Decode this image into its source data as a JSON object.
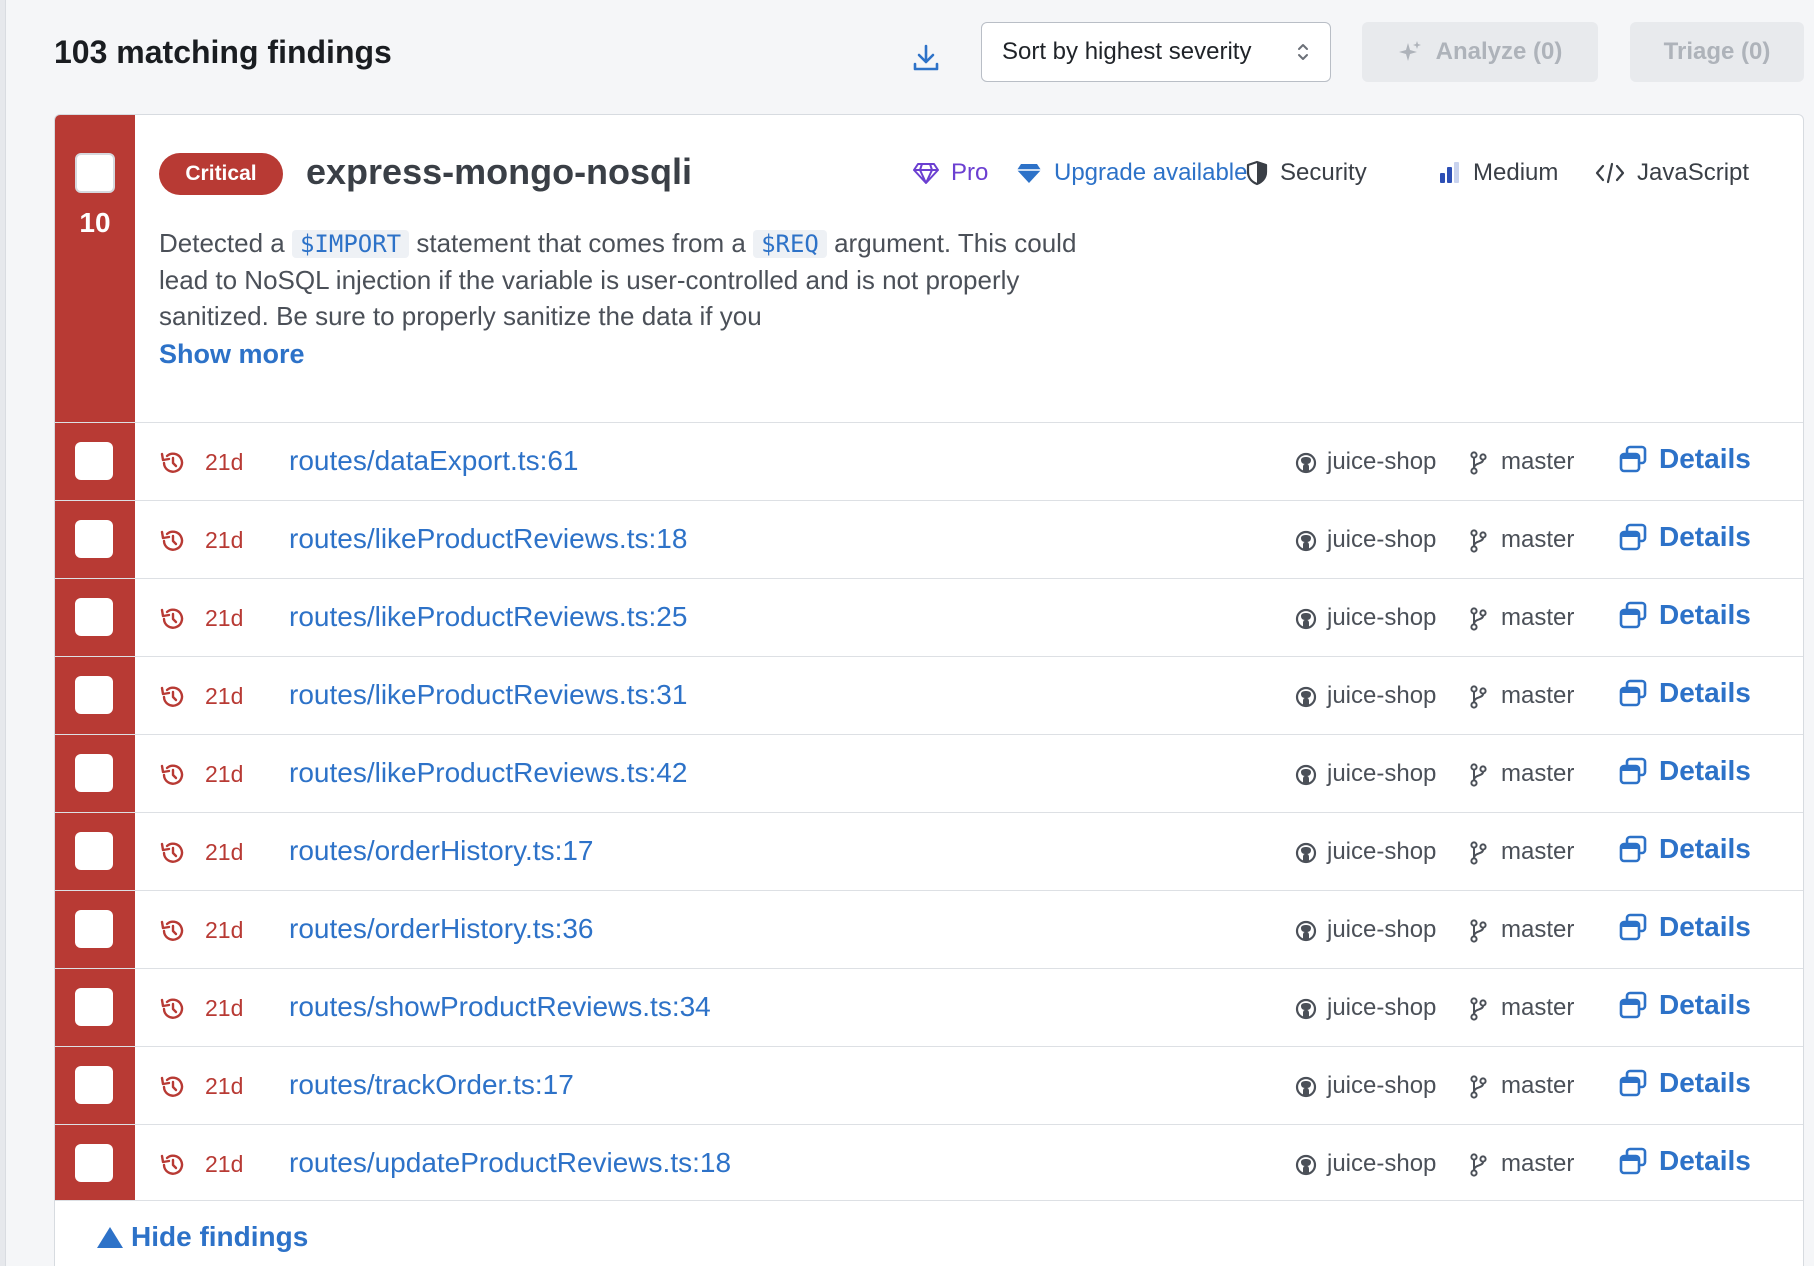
{
  "header": {
    "title": "103 matching findings",
    "download_icon": "download-icon",
    "sort_label": "Sort by highest severity",
    "analyze_label": "Analyze (0)",
    "triage_label": "Triage (0)"
  },
  "finding": {
    "count": "10",
    "severity": "Critical",
    "rule_name": "express-mongo-nosqli",
    "meta": {
      "pro": "Pro",
      "upgrade": "Upgrade available",
      "category": "Security",
      "confidence": "Medium",
      "language": "JavaScript"
    },
    "description": {
      "part1": "Detected a ",
      "code1": "$IMPORT",
      "part2": " statement that comes from a ",
      "code2": "$REQ",
      "part3": " argument. This could lead to NoSQL injection if the variable is user-controlled and is not properly sanitized. Be sure to properly sanitize the data if you"
    },
    "show_more": "Show more",
    "hide_findings": "Hide findings"
  },
  "colors": {
    "critical": "#b83a34",
    "link": "#2d72c8",
    "pro": "#6b3fd1"
  },
  "rows": [
    {
      "age": "21d",
      "path": "routes/dataExport.ts:61",
      "repo": "juice-shop",
      "branch": "master",
      "details": "Details"
    },
    {
      "age": "21d",
      "path": "routes/likeProductReviews.ts:18",
      "repo": "juice-shop",
      "branch": "master",
      "details": "Details"
    },
    {
      "age": "21d",
      "path": "routes/likeProductReviews.ts:25",
      "repo": "juice-shop",
      "branch": "master",
      "details": "Details"
    },
    {
      "age": "21d",
      "path": "routes/likeProductReviews.ts:31",
      "repo": "juice-shop",
      "branch": "master",
      "details": "Details"
    },
    {
      "age": "21d",
      "path": "routes/likeProductReviews.ts:42",
      "repo": "juice-shop",
      "branch": "master",
      "details": "Details"
    },
    {
      "age": "21d",
      "path": "routes/orderHistory.ts:17",
      "repo": "juice-shop",
      "branch": "master",
      "details": "Details"
    },
    {
      "age": "21d",
      "path": "routes/orderHistory.ts:36",
      "repo": "juice-shop",
      "branch": "master",
      "details": "Details"
    },
    {
      "age": "21d",
      "path": "routes/showProductReviews.ts:34",
      "repo": "juice-shop",
      "branch": "master",
      "details": "Details"
    },
    {
      "age": "21d",
      "path": "routes/trackOrder.ts:17",
      "repo": "juice-shop",
      "branch": "master",
      "details": "Details"
    },
    {
      "age": "21d",
      "path": "routes/updateProductReviews.ts:18",
      "repo": "juice-shop",
      "branch": "master",
      "details": "Details"
    }
  ]
}
